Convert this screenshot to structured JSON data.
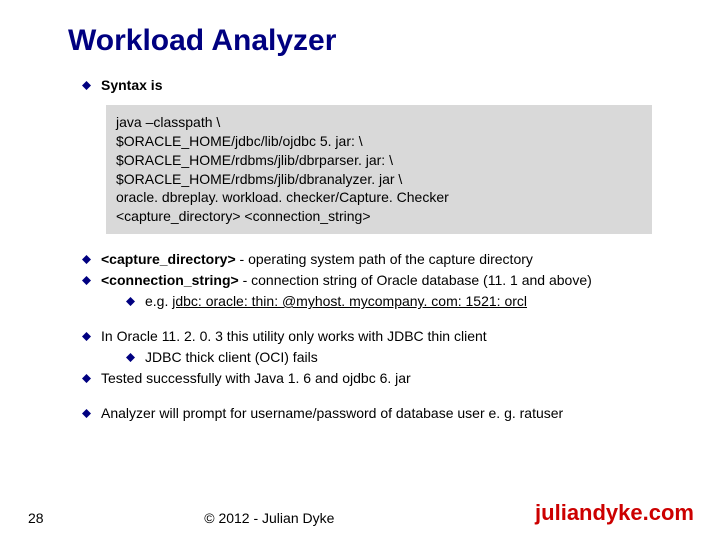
{
  "title": "Workload Analyzer",
  "bullets": {
    "syntax": "Syntax is",
    "capdir_prefix": "<capture_directory>",
    "capdir_rest": " - operating system path of the capture directory",
    "connstr_prefix": "<connection_string>",
    "connstr_rest": " - connection string of Oracle database (11. 1 and above)",
    "eg_prefix": "e.g. ",
    "eg_value": "jdbc: oracle: thin: @myhost. mycompany. com: 1521: orcl",
    "thin": "In Oracle 11. 2. 0. 3 this utility only works with JDBC thin client",
    "thick": "JDBC thick client (OCI) fails",
    "tested": "Tested successfully with Java 1. 6 and ojdbc 6. jar",
    "prompt": "Analyzer will prompt for username/password of database user e. g. ratuser"
  },
  "code": {
    "l1": "java –classpath \\",
    "l2": "$ORACLE_HOME/jdbc/lib/ojdbc 5. jar: \\",
    "l3": "$ORACLE_HOME/rdbms/jlib/dbrparser. jar: \\",
    "l4": "$ORACLE_HOME/rdbms/jlib/dbranalyzer. jar \\",
    "l5": "oracle. dbreplay. workload. checker/Capture. Checker",
    "l6": "<capture_directory> <connection_string>"
  },
  "footer": {
    "page": "28",
    "copyright": "© 2012 - Julian Dyke",
    "brand": "juliandyke.com"
  }
}
